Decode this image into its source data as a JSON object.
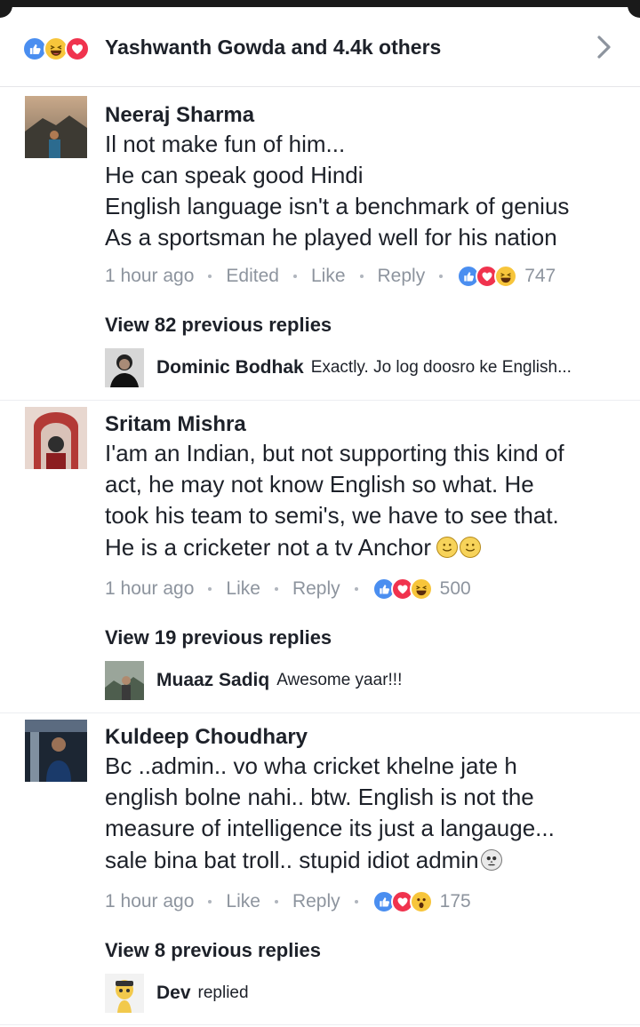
{
  "reactions_summary": {
    "text": "Yashwanth Gowda and 4.4k others",
    "icons": [
      "like-icon",
      "haha-icon",
      "love-icon"
    ]
  },
  "comments": [
    {
      "name": "Neeraj Sharma",
      "lines": [
        "Il not make fun of him...",
        "He can speak good Hindi",
        "English language isn't a benchmark of genius",
        "As a sportsman he played well for his nation"
      ],
      "time": "1 hour ago",
      "edited": "Edited",
      "like": "Like",
      "reply": "Reply",
      "reaction_icons": [
        "like-icon",
        "love-icon",
        "haha-icon"
      ],
      "reaction_count": "747",
      "view_replies": "View 82 previous replies",
      "latest_reply": {
        "name": "Dominic Bodhak",
        "text": "Exactly. Jo log doosro ke English..."
      }
    },
    {
      "name": "Sritam Mishra",
      "lines": [
        "I'am an Indian, but not supporting this kind of",
        "act, he may not know English so what. He",
        "took his team to semi's, we have to see that.",
        "He is a cricketer not a tv Anchor"
      ],
      "trailing_emoji": [
        "smile-emoji",
        "smile-emoji"
      ],
      "time": "1 hour ago",
      "like": "Like",
      "reply": "Reply",
      "reaction_icons": [
        "like-icon",
        "love-icon",
        "haha-icon"
      ],
      "reaction_count": "500",
      "view_replies": "View 19 previous replies",
      "latest_reply": {
        "name": "Muaaz Sadiq",
        "text": "Awesome yaar!!!"
      }
    },
    {
      "name": "Kuldeep Choudhary",
      "lines": [
        "Bc ..admin.. vo wha cricket khelne jate h",
        "english bolne nahi.. btw. English is not the",
        "measure of intelligence its just a langauge...",
        "sale bina bat troll.. stupid idiot admin"
      ],
      "trailing_emoji": [
        "skull-emoji"
      ],
      "time": "1 hour ago",
      "like": "Like",
      "reply": "Reply",
      "reaction_icons": [
        "like-icon",
        "love-icon",
        "wow-icon"
      ],
      "reaction_count": "175",
      "view_replies": "View 8 previous replies",
      "latest_reply": {
        "name": "Dev",
        "text": "replied"
      }
    }
  ],
  "colors": {
    "like": "#4a8ef0",
    "love": "#f0334e",
    "haha": "#f7c53b",
    "meta_text": "#8d949e",
    "text": "#1d2129"
  }
}
